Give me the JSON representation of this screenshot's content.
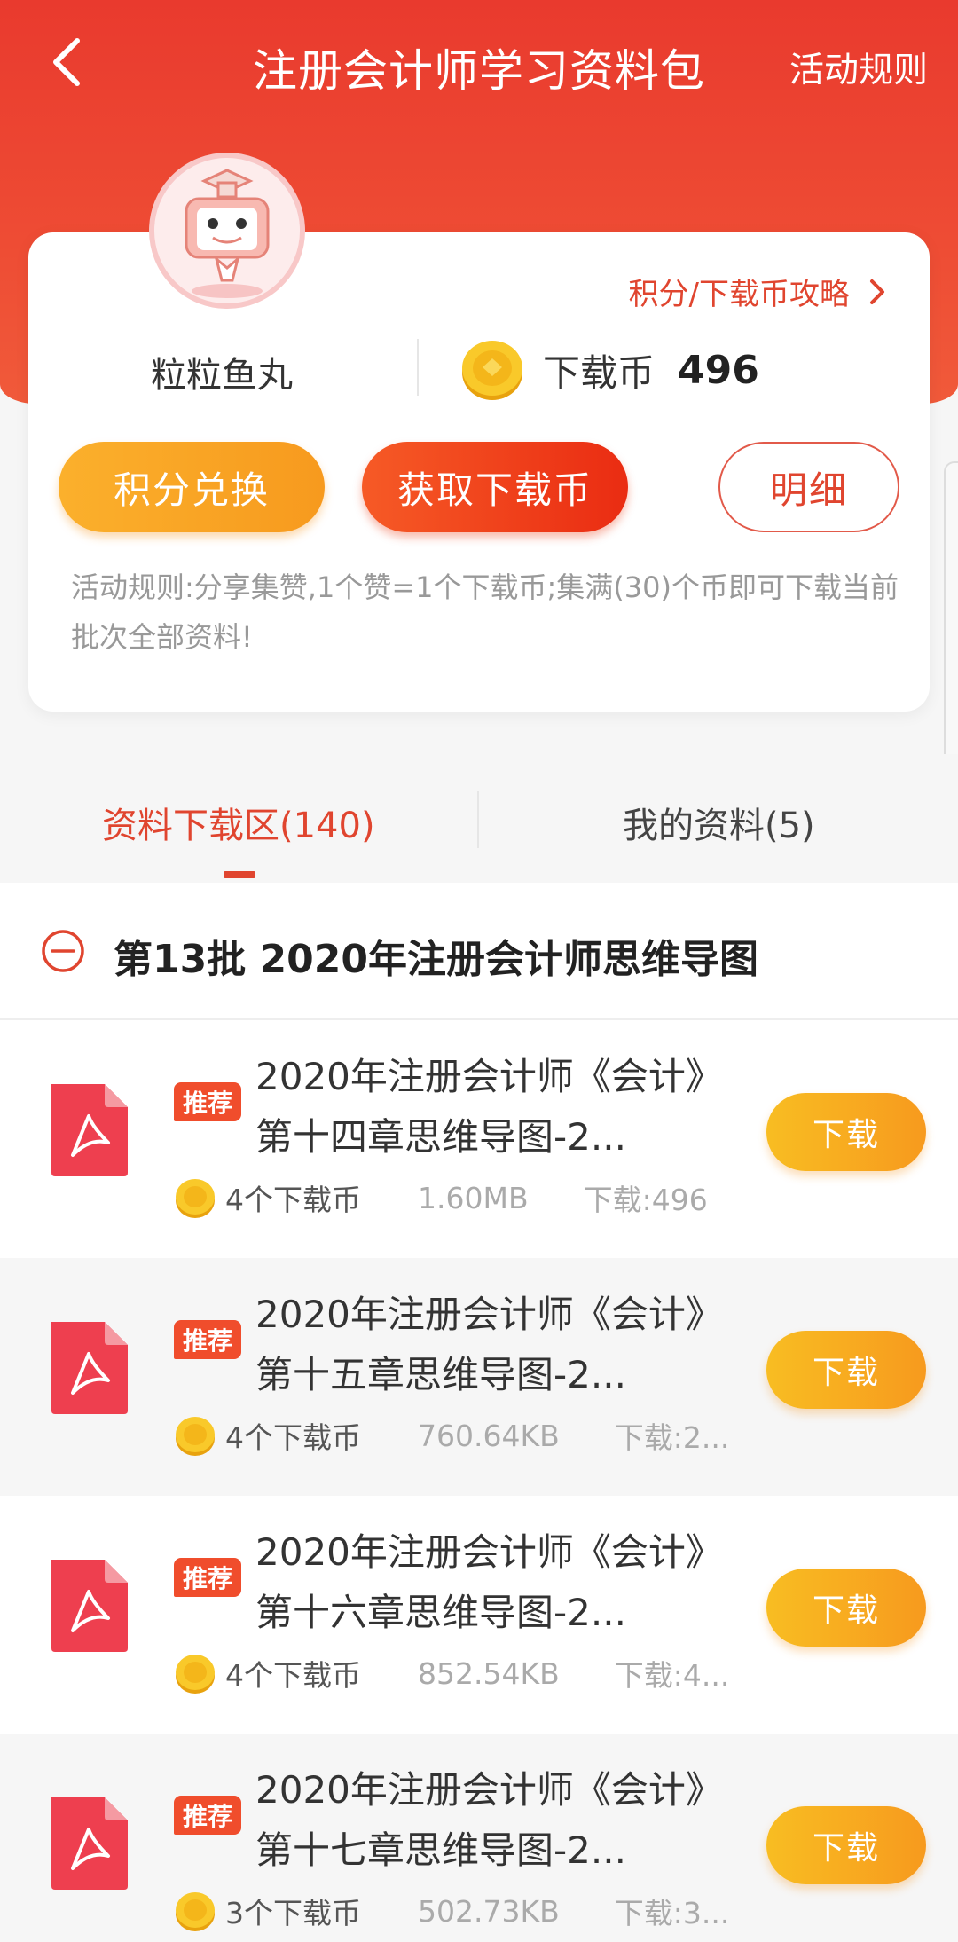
{
  "header": {
    "title": "注册会计师学习资料包",
    "rules_link": "活动规则"
  },
  "card": {
    "strategy_link": "积分/下载币攻略",
    "username": "粒粒鱼丸",
    "coin_label": "下载币",
    "coin_value": "496",
    "buttons": {
      "exchange": "积分兑换",
      "get_coins": "获取下载币",
      "detail": "明细"
    },
    "rule_text": "活动规则:分享集赞,1个赞=1个下载币;集满(30)个币即可下载当前批次全部资料!"
  },
  "tabs": {
    "download_area": "资料下载区(140)",
    "my_materials": "我的资料(5)"
  },
  "section": {
    "title": "第13批 2020年注册会计师思维导图"
  },
  "items": [
    {
      "badge": "推荐",
      "title": "2020年注册会计师《会计》第十四章思维导图-2...",
      "cost": "4个下载币",
      "size": "1.60MB",
      "downloads": "下载:496",
      "button": "下载"
    },
    {
      "badge": "推荐",
      "title": "2020年注册会计师《会计》第十五章思维导图-2...",
      "cost": "4个下载币",
      "size": "760.64KB",
      "downloads": "下载:2...",
      "button": "下载"
    },
    {
      "badge": "推荐",
      "title": "2020年注册会计师《会计》第十六章思维导图-2...",
      "cost": "4个下载币",
      "size": "852.54KB",
      "downloads": "下载:4...",
      "button": "下载"
    },
    {
      "badge": "推荐",
      "title": "2020年注册会计师《会计》第十七章思维导图-2...",
      "cost": "3个下载币",
      "size": "502.73KB",
      "downloads": "下载:3...",
      "button": "下载"
    }
  ],
  "colors": {
    "brand_red": "#e93a2e",
    "accent_orange": "#f79a1e",
    "link_red": "#e0452f"
  }
}
